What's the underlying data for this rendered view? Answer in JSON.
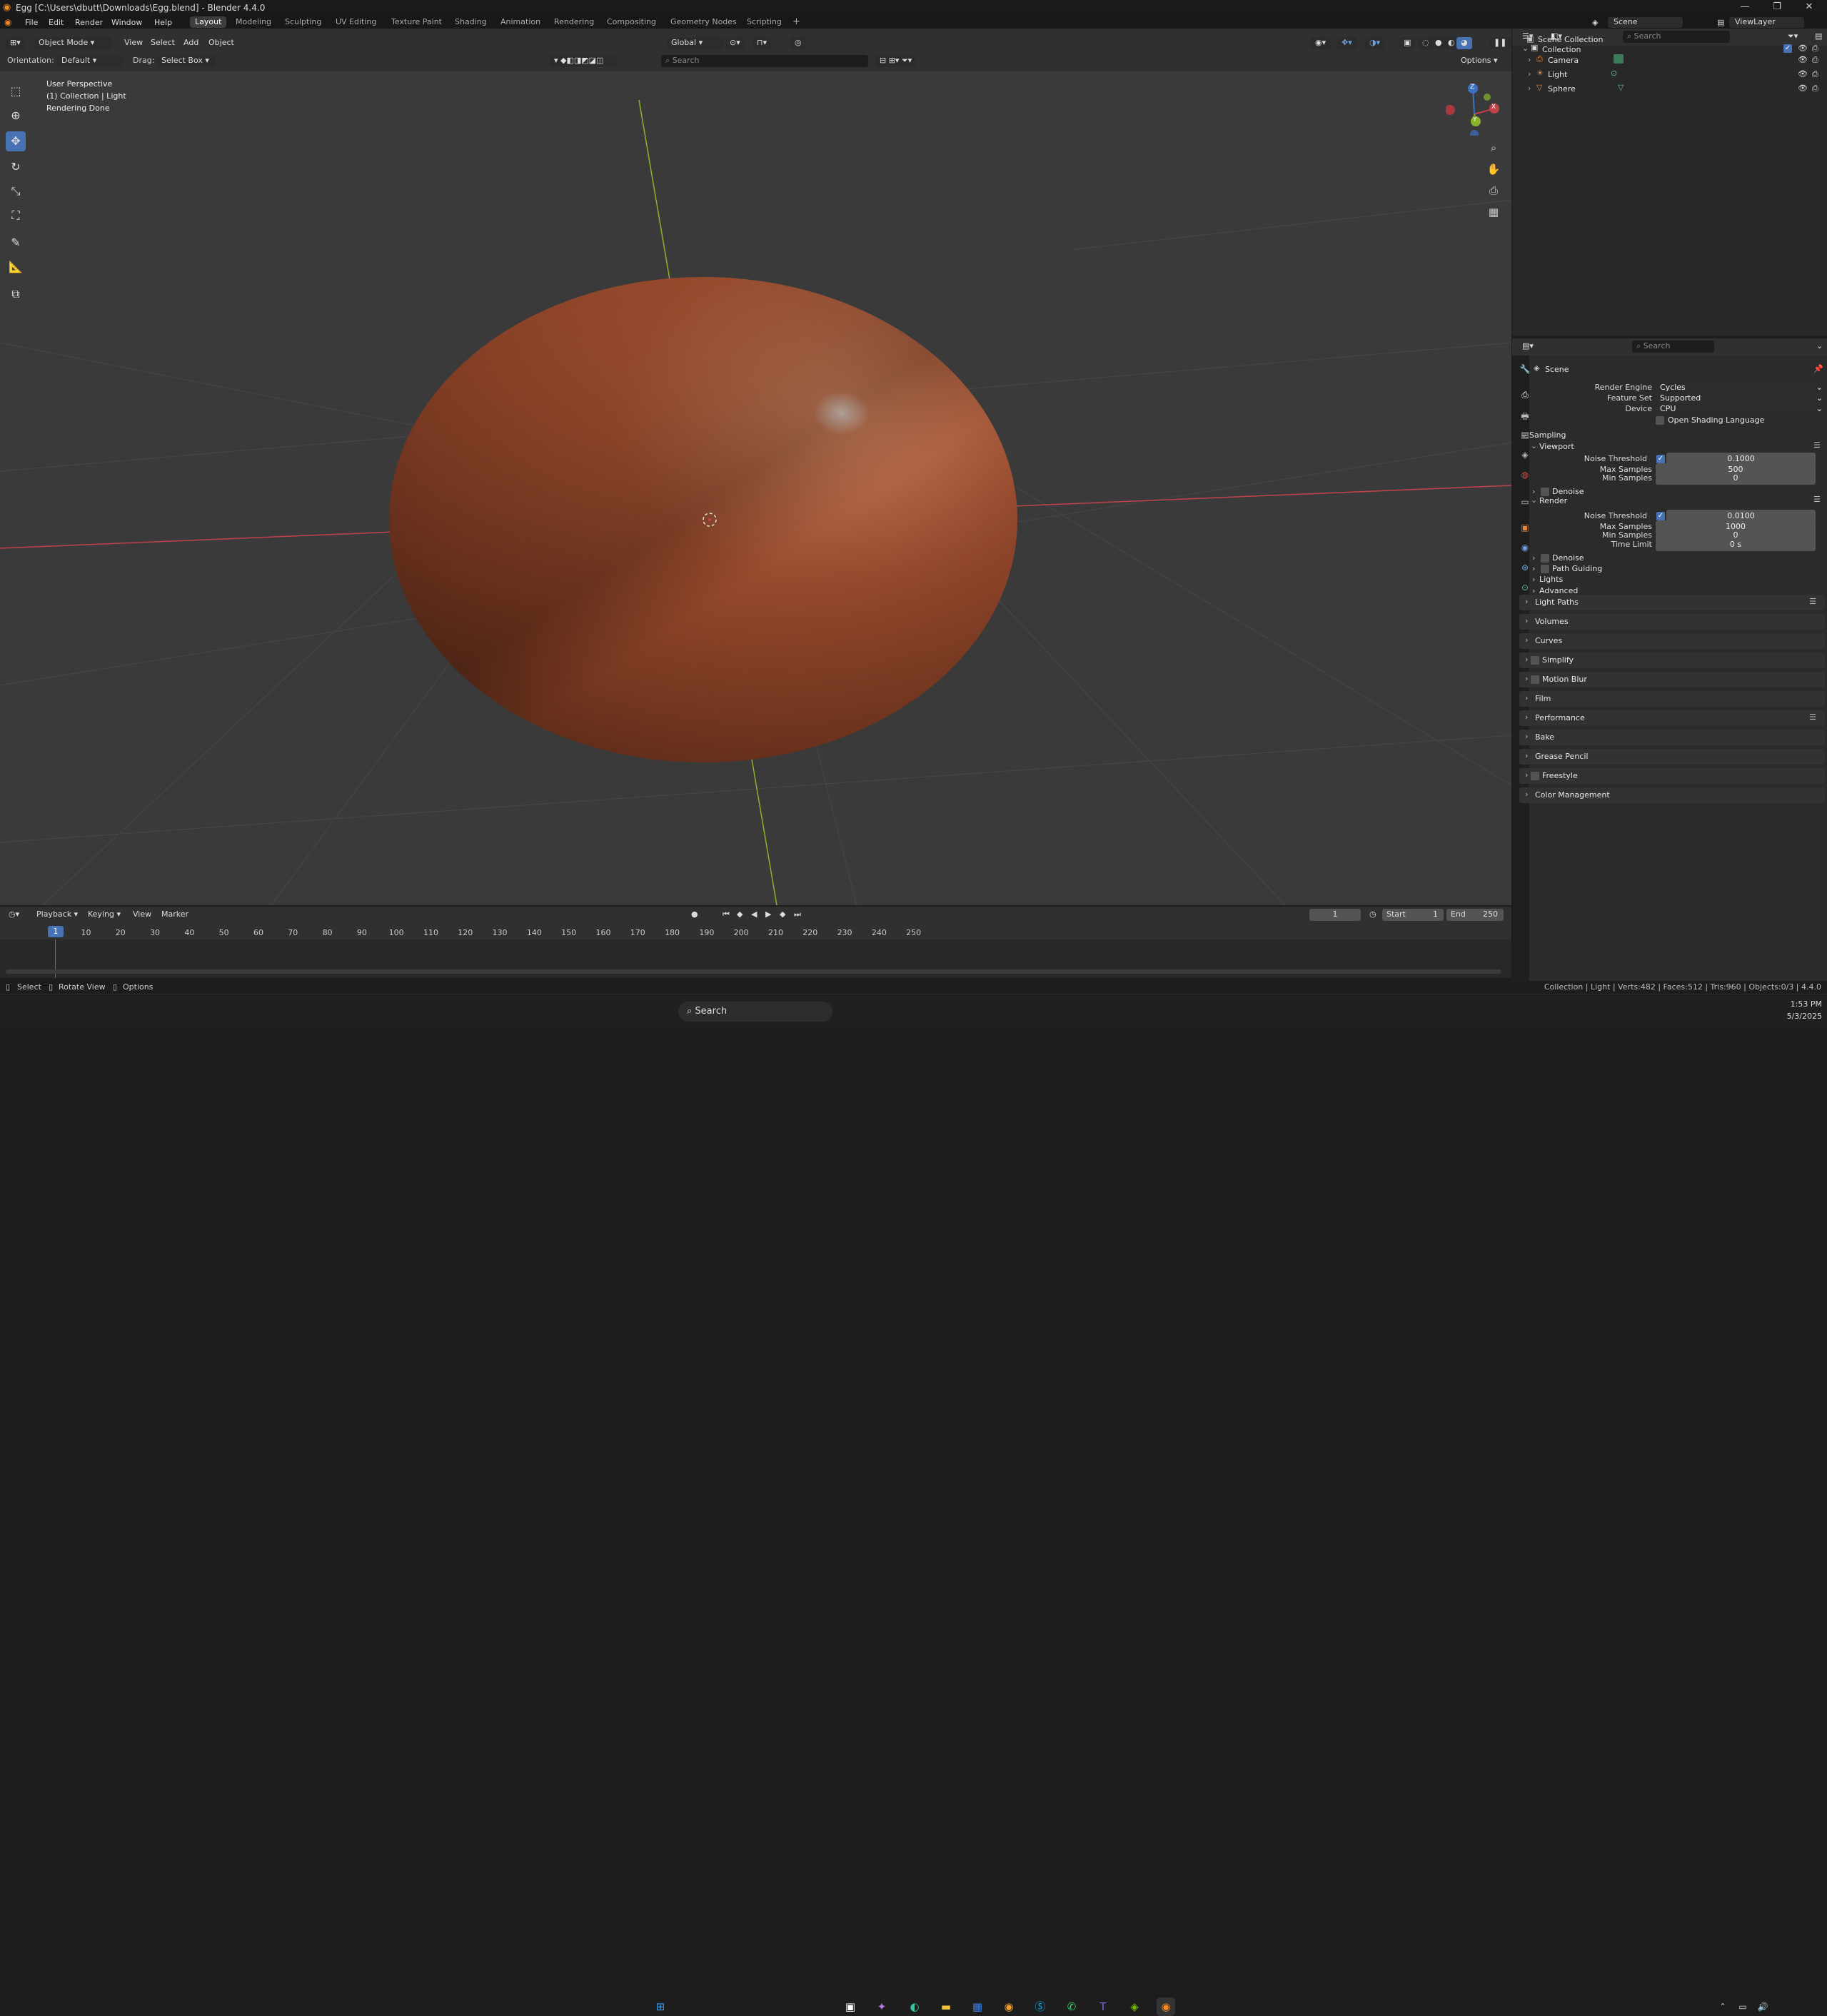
{
  "window": {
    "title": "Egg [C:\\Users\\dbutt\\Downloads\\Egg.blend] - Blender 4.4.0"
  },
  "menu": [
    "File",
    "Edit",
    "Render",
    "Window",
    "Help"
  ],
  "workspaces": [
    "Layout",
    "Modeling",
    "Sculpting",
    "UV Editing",
    "Texture Paint",
    "Shading",
    "Animation",
    "Rendering",
    "Compositing",
    "Geometry Nodes",
    "Scripting"
  ],
  "topbar": {
    "scene": "Scene",
    "view_layer": "ViewLayer"
  },
  "viewport_header": {
    "mode": "Object Mode",
    "menus": [
      "View",
      "Select",
      "Add",
      "Object"
    ],
    "transform": "Global",
    "orientation_label": "Orientation:",
    "orientation": "Default",
    "drag_label": "Drag:",
    "drag": "Select Box",
    "search_placeholder": "Search",
    "options": "Options"
  },
  "viewport": {
    "lines": [
      "User Perspective",
      "(1) Collection | Light",
      "Rendering Done"
    ]
  },
  "gizmo": {
    "x": "X",
    "y": "Y",
    "z": "Z"
  },
  "timeline": {
    "menus": [
      "Playback",
      "Keying",
      "View",
      "Marker"
    ],
    "current_frame": "1",
    "start_label": "Start",
    "start": "1",
    "end_label": "End",
    "end": "250",
    "ticks": [
      "10",
      "20",
      "30",
      "40",
      "50",
      "60",
      "70",
      "80",
      "90",
      "100",
      "110",
      "120",
      "130",
      "140",
      "150",
      "160",
      "170",
      "180",
      "190",
      "200",
      "210",
      "220",
      "230",
      "240",
      "250"
    ],
    "playhead": "1"
  },
  "outliner": {
    "search_placeholder": "Search",
    "root": "Scene Collection",
    "collection": "Collection",
    "items": [
      "Camera",
      "Light",
      "Sphere"
    ]
  },
  "properties": {
    "search_placeholder": "Search",
    "context": "Scene",
    "render_engine_label": "Render Engine",
    "render_engine": "Cycles",
    "feature_set_label": "Feature Set",
    "feature_set": "Supported",
    "device_label": "Device",
    "device": "CPU",
    "osl": "Open Shading Language",
    "sampling": "Sampling",
    "viewport": "Viewport",
    "noise_threshold_label": "Noise Threshold",
    "vp_noise": "0.1000",
    "max_samples_label": "Max Samples",
    "vp_max": "500",
    "min_samples_label": "Min Samples",
    "vp_min": "0",
    "denoise": "Denoise",
    "render": "Render",
    "r_noise": "0.0100",
    "r_max": "1000",
    "r_min": "0",
    "time_limit_label": "Time Limit",
    "time_limit": "0 s",
    "path_guiding": "Path Guiding",
    "lights": "Lights",
    "advanced": "Advanced",
    "sections": [
      "Light Paths",
      "Volumes",
      "Curves",
      "Simplify",
      "Motion Blur",
      "Film",
      "Performance",
      "Bake",
      "Grease Pencil",
      "Freestyle",
      "Color Management"
    ]
  },
  "statusbar": {
    "select": "Select",
    "rotate": "Rotate View",
    "options": "Options",
    "stats": "Collection | Light | Verts:482 | Faces:512 | Tris:960 | Objects:0/3 | 4.4.0"
  },
  "taskbar": {
    "search": "Search",
    "time": "1:53 PM",
    "date": "5/3/2025"
  },
  "colors": {
    "accent": "#4772b3",
    "egg": "#a04e2f",
    "x_axis": "#c2424a",
    "y_axis": "#8ab32b",
    "z_axis": "#3b72c4"
  }
}
